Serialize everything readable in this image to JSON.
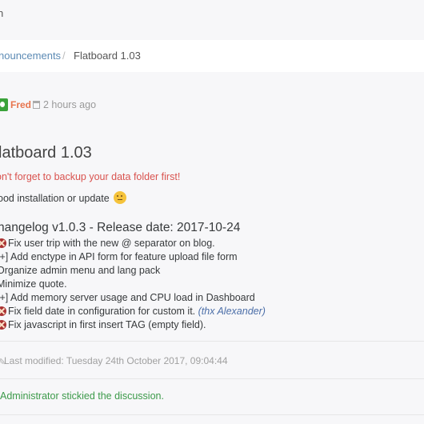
{
  "topbar": {
    "nav_text": "n"
  },
  "breadcrumb": {
    "link_text": "nouncements",
    "separator": "/",
    "current": "Flatboard 1.03"
  },
  "post": {
    "author": "Fred",
    "time": "2 hours ago",
    "title": "latboard 1.03",
    "warning": "on't forget to backup your data folder first!",
    "good_line": "ood installation or update",
    "changelog_heading": "hangelog v1.0.3 - Release date: 2017-10-24",
    "changes": [
      {
        "icon": "bug-icon",
        "text": "Fix user trip with the new @ separator on blog."
      },
      {
        "icon": "",
        "text": "[+] Add enctype in API form for feature upload file form"
      },
      {
        "icon": "",
        "text": "Organize admin menu and lang pack"
      },
      {
        "icon": "",
        "text": "Minimize quote."
      },
      {
        "icon": "",
        "text": "[+] Add memory server usage and CPU load in Dashboard"
      },
      {
        "icon": "bug-icon",
        "text": "Fix field date in configuration for custom it. ",
        "extra": "(thx Alexander)"
      },
      {
        "icon": "bug-icon",
        "text": "Fix javascript in first insert TAG (empty field)."
      }
    ],
    "modified": "Last modified: Tuesday 24th October 2017, 09:04:44",
    "sticky": "Administrator stickied the discussion."
  },
  "colors": {
    "author": "#e8744d",
    "warning": "#d9534f",
    "link": "#5b8ab4",
    "sticky": "#3c9a4a",
    "bug": "#aa3333"
  }
}
